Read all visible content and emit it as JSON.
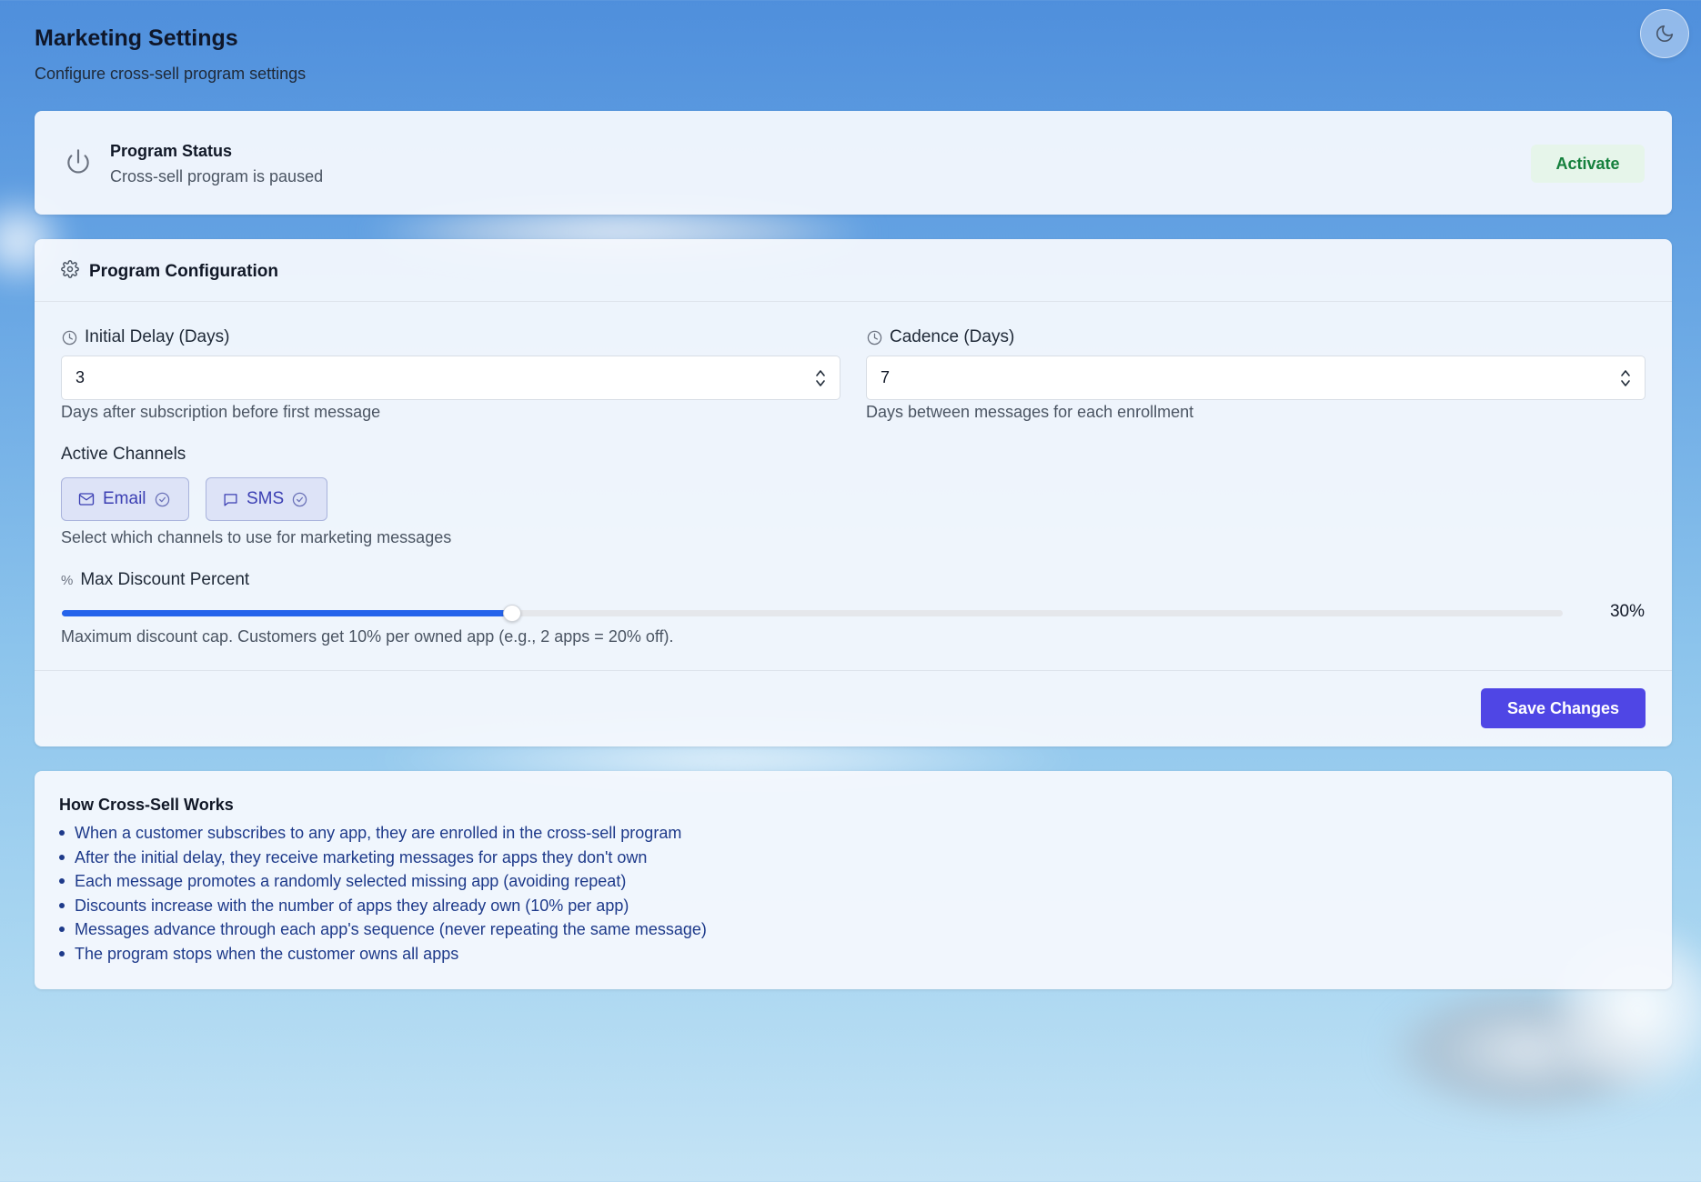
{
  "header": {
    "title": "Marketing Settings",
    "subtitle": "Configure cross-sell program settings"
  },
  "theme_toggle": {
    "icon": "moon-icon"
  },
  "status": {
    "title": "Program Status",
    "text": "Cross-sell program is paused",
    "activate_label": "Activate"
  },
  "config": {
    "title": "Program Configuration",
    "initial_delay": {
      "label": "Initial Delay (Days)",
      "value": "3",
      "hint": "Days after subscription before first message"
    },
    "cadence": {
      "label": "Cadence (Days)",
      "value": "7",
      "hint": "Days between messages for each enrollment"
    },
    "channels": {
      "label": "Active Channels",
      "items": [
        {
          "label": "Email",
          "icon": "mail-icon",
          "selected": true
        },
        {
          "label": "SMS",
          "icon": "message-icon",
          "selected": true
        }
      ],
      "hint": "Select which channels to use for marketing messages"
    },
    "max_discount": {
      "label": "Max Discount Percent",
      "value": 30,
      "value_text": "30%",
      "max": 100,
      "hint": "Maximum discount cap. Customers get 10% per owned app (e.g., 2 apps = 20% off)."
    },
    "save_label": "Save Changes"
  },
  "how": {
    "title": "How Cross-Sell Works",
    "items": [
      "When a customer subscribes to any app, they are enrolled in the cross-sell program",
      "After the initial delay, they receive marketing messages for apps they don't own",
      "Each message promotes a randomly selected missing app (avoiding repeat)",
      "Discounts increase with the number of apps they already own (10% per app)",
      "Messages advance through each app's sequence (never repeating the same message)",
      "The program stops when the customer owns all apps"
    ]
  },
  "colors": {
    "accent": "#4f46e5",
    "slider_fill": "#2563eb",
    "activate_text": "#15803d",
    "list_text": "#1e3a8a"
  }
}
